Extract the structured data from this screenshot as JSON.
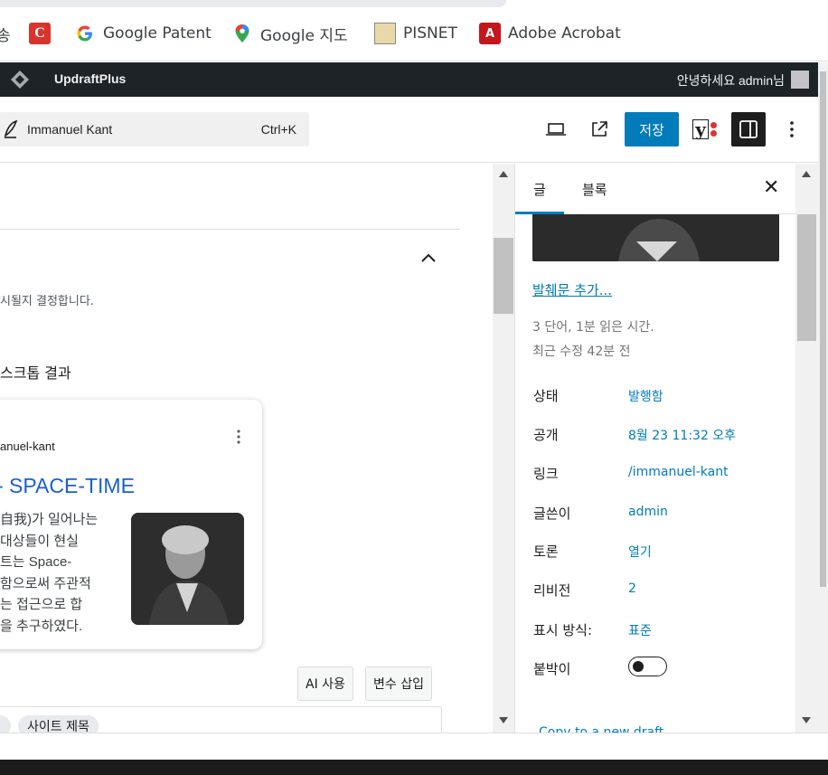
{
  "bookmarks": [
    {
      "label": "송",
      "icon": "truncated-icon"
    },
    {
      "label": "",
      "icon": "c-logo-icon"
    },
    {
      "label": "Google Patent",
      "icon": "google-g-icon"
    },
    {
      "label": "Google 지도",
      "icon": "google-maps-pin-icon"
    },
    {
      "label": "PISNET",
      "icon": "pisnet-icon"
    },
    {
      "label": "Adobe Acrobat",
      "icon": "adobe-acrobat-icon"
    }
  ],
  "adminbar": {
    "brand": "UpdraftPlus",
    "greeting": "안녕하세요 admin님"
  },
  "header": {
    "doc_title": "Immanuel Kant",
    "shortcut": "Ctrl+K",
    "save_label": "저장",
    "yoast_label": "y"
  },
  "main": {
    "description": "시될지 결정합니다.",
    "section_heading": "스크톱 결과",
    "preview": {
      "slug": "anuel-kant",
      "title": "- SPACE-TIME",
      "snippet_lines": [
        "自我)가 일어나는",
        "대상들이 현실",
        "트는 Space-",
        "함으로써 주관적",
        "는 접근으로 합",
        "을 추구하였다."
      ]
    },
    "ai_button": "AI 사용",
    "insert_var_button": "변수 삽입",
    "tags": [
      "",
      "사이트 제목"
    ]
  },
  "sidebar": {
    "tabs": [
      "글",
      "블록"
    ],
    "excerpt_link": "발췌문 추가...",
    "word_count": "3 단어, 1분 읽은 시간.",
    "last_edited": "최근 수정 42분 전",
    "rows": [
      {
        "label": "상태",
        "value": "발행함"
      },
      {
        "label": "공개",
        "value": "8월 23 11:32 오후"
      },
      {
        "label": "링크",
        "value": "/immanuel-kant"
      },
      {
        "label": "글쓴이",
        "value": "admin"
      },
      {
        "label": "토론",
        "value": "열기"
      },
      {
        "label": "리비전",
        "value": "2"
      },
      {
        "label": "표시 방식:",
        "value": "표준"
      }
    ],
    "sticky_label": "붙박이",
    "copy_link": "Copy to a new draft"
  },
  "colors": {
    "accent": "#007cba",
    "adminbar": "#1d2327",
    "link": "#1a5fd0"
  }
}
